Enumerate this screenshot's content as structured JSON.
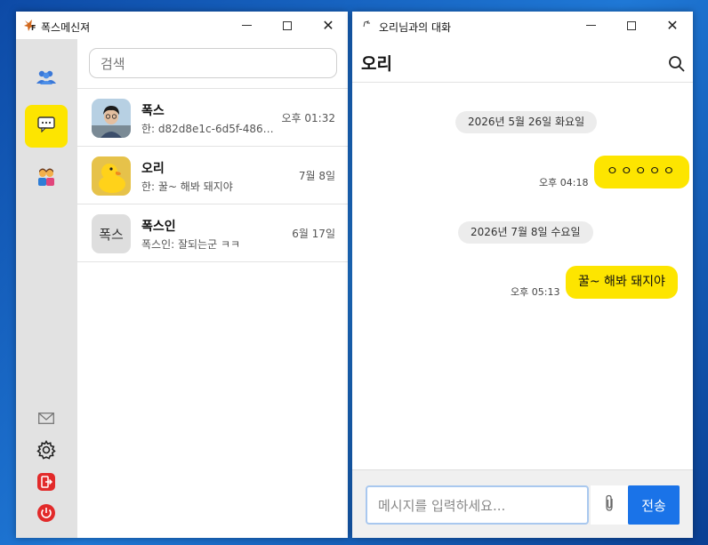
{
  "left_window": {
    "title": "폭스메신져",
    "search_placeholder": "검색",
    "chats": [
      {
        "name": "폭스",
        "preview": "한: d82d8e1c-6d5f-486e-9...",
        "time": "오후 01:32",
        "avatar": "photo"
      },
      {
        "name": "오리",
        "preview": "한: 꿀~ 해봐 돼지야",
        "time": "7월 8일",
        "avatar": "duck"
      },
      {
        "name": "폭스인",
        "preview": "폭스인: 잘되는군 ㅋㅋ",
        "time": "6월 17일",
        "avatar_text": "폭스"
      }
    ],
    "rail_icons": [
      "friends-icon",
      "chat-icon",
      "couple-icon",
      "mail-icon",
      "settings-icon",
      "logout-icon",
      "power-icon"
    ]
  },
  "right_window": {
    "title": "오리님과의 대화",
    "chat_name": "오리",
    "messages": [
      {
        "date": "2026년 5월 26일 화요일"
      },
      {
        "text": "ㅇㅇㅇㅇㅇ",
        "time": "오후 04:18"
      },
      {
        "date": "2026년 7월 8일 수요일"
      },
      {
        "text": "꿀~ 해봐 돼지야",
        "time": "오후 05:13"
      }
    ],
    "input_placeholder": "메시지를 입력하세요...",
    "send_label": "전송"
  },
  "colors": {
    "accent": "#fde500",
    "send": "#1a73e8",
    "rail": "#e2e2e2"
  }
}
